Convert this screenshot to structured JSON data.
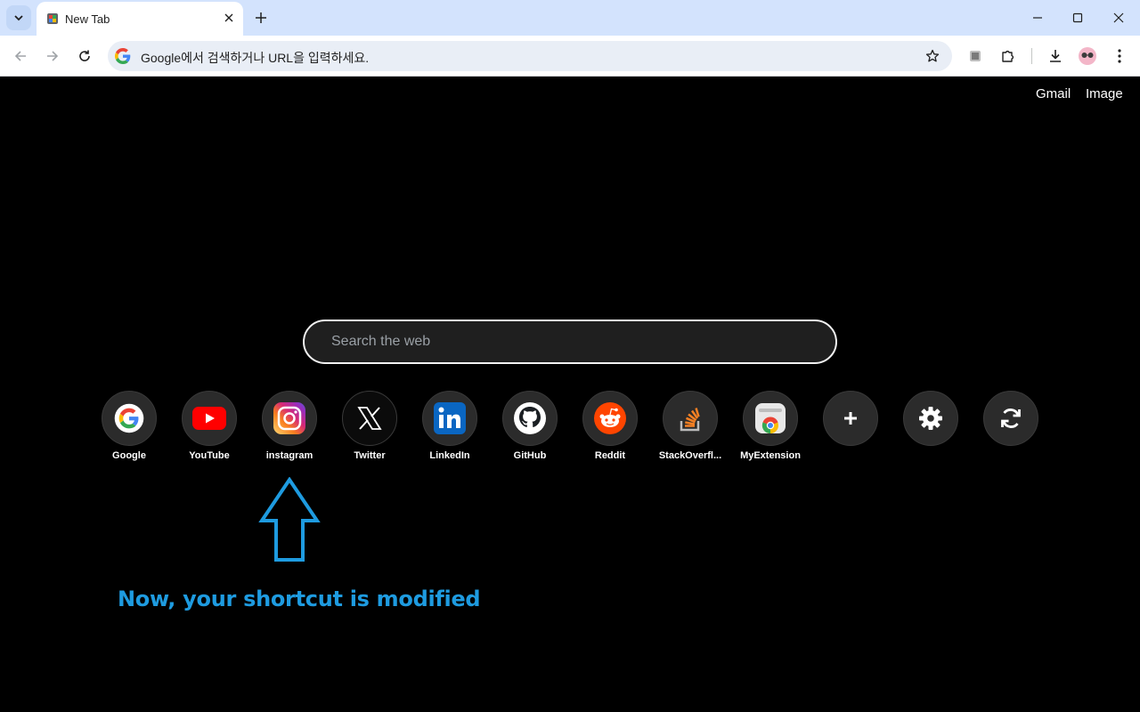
{
  "browser": {
    "tab_title": "New Tab",
    "omnibox_placeholder": "Google에서 검색하거나 URL을 입력하세요."
  },
  "page": {
    "top_links": [
      "Gmail",
      "Image"
    ],
    "search_placeholder": "Search the web",
    "shortcuts": [
      {
        "label": "Google",
        "icon": "google-icon"
      },
      {
        "label": "YouTube",
        "icon": "youtube-icon"
      },
      {
        "label": "instagram",
        "icon": "instagram-icon"
      },
      {
        "label": "Twitter",
        "icon": "x-icon"
      },
      {
        "label": "LinkedIn",
        "icon": "linkedin-icon"
      },
      {
        "label": "GitHub",
        "icon": "github-icon"
      },
      {
        "label": "Reddit",
        "icon": "reddit-icon"
      },
      {
        "label": "StackOverfl...",
        "icon": "stackoverflow-icon"
      },
      {
        "label": "MyExtension",
        "icon": "chrome-extension-icon"
      }
    ],
    "controls": [
      {
        "icon": "add-icon"
      },
      {
        "icon": "gear-icon"
      },
      {
        "icon": "sync-icon"
      }
    ],
    "annotation": "Now, your shortcut is modified"
  },
  "colors": {
    "annotation": "#1e9be0",
    "tab_strip": "#d3e3fd"
  }
}
